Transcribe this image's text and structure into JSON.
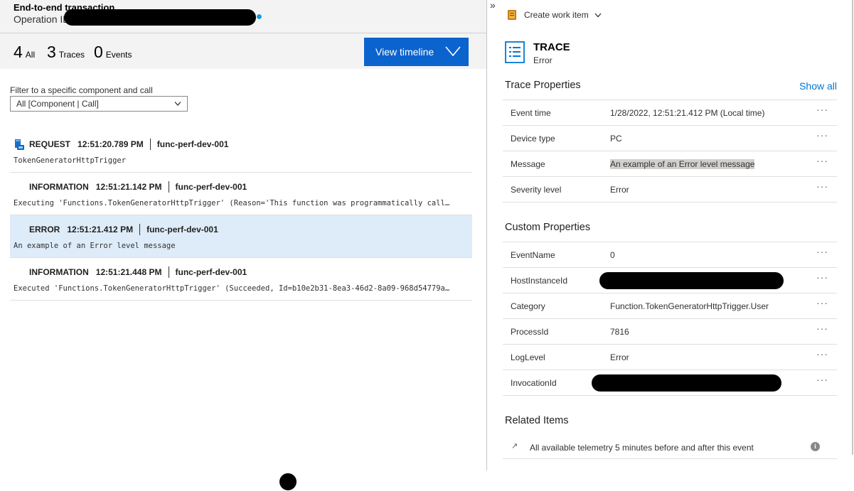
{
  "header": {
    "title": "End-to-end transaction",
    "operation_label": "Operation ID"
  },
  "counts": [
    {
      "num": "4",
      "label": "All"
    },
    {
      "num": "3",
      "label": "Traces"
    },
    {
      "num": "0",
      "label": "Events"
    }
  ],
  "view_timeline_label": "View timeline",
  "filter": {
    "label": "Filter to a specific component and call",
    "value": "All [Component | Call]"
  },
  "rows": [
    {
      "type": "REQUEST",
      "time": "12:51:20.789 PM",
      "component": "func-perf-dev-001",
      "desc": "TokenGeneratorHttpTrigger"
    },
    {
      "type": "INFORMATION",
      "time": "12:51:21.142 PM",
      "component": "func-perf-dev-001",
      "desc": "Executing 'Functions.TokenGeneratorHttpTrigger' (Reason='This function was programmatically call…"
    },
    {
      "type": "ERROR",
      "time": "12:51:21.412 PM",
      "component": "func-perf-dev-001",
      "desc": "An example of an Error level message"
    },
    {
      "type": "INFORMATION",
      "time": "12:51:21.448 PM",
      "component": "func-perf-dev-001",
      "desc": "Executed 'Functions.TokenGeneratorHttpTrigger' (Succeeded, Id=b10e2b31-8ea3-46d2-8a09-968d54779a…"
    }
  ],
  "right": {
    "collapse_glyph": "»",
    "create_work_item": "Create work item",
    "trace_title": "TRACE",
    "trace_subtitle": "Error",
    "trace_properties_title": "Trace Properties",
    "show_all": "Show all",
    "trace_properties": [
      {
        "key": "Event time",
        "value": "1/28/2022, 12:51:21.412 PM (Local time)"
      },
      {
        "key": "Device type",
        "value": "PC"
      },
      {
        "key": "Message",
        "value": "An example of an Error level message"
      },
      {
        "key": "Severity level",
        "value": "Error"
      }
    ],
    "custom_properties_title": "Custom Properties",
    "custom_properties": [
      {
        "key": "EventName",
        "value": "0"
      },
      {
        "key": "HostInstanceId",
        "value": ""
      },
      {
        "key": "Category",
        "value": "Function.TokenGeneratorHttpTrigger.User"
      },
      {
        "key": "ProcessId",
        "value": "7816"
      },
      {
        "key": "LogLevel",
        "value": "Error"
      },
      {
        "key": "InvocationId",
        "value": ""
      }
    ],
    "related_items_title": "Related Items",
    "related_item": "All available telemetry 5 minutes before and after this event",
    "more_glyph": "···",
    "arrow_glyph": "↗",
    "info_glyph": "i"
  },
  "colors": {
    "accent_blue": "#0b63ce",
    "link_blue": "#0078d4",
    "selected_row": "#deecf9",
    "header_bg": "#f3f3f3"
  }
}
